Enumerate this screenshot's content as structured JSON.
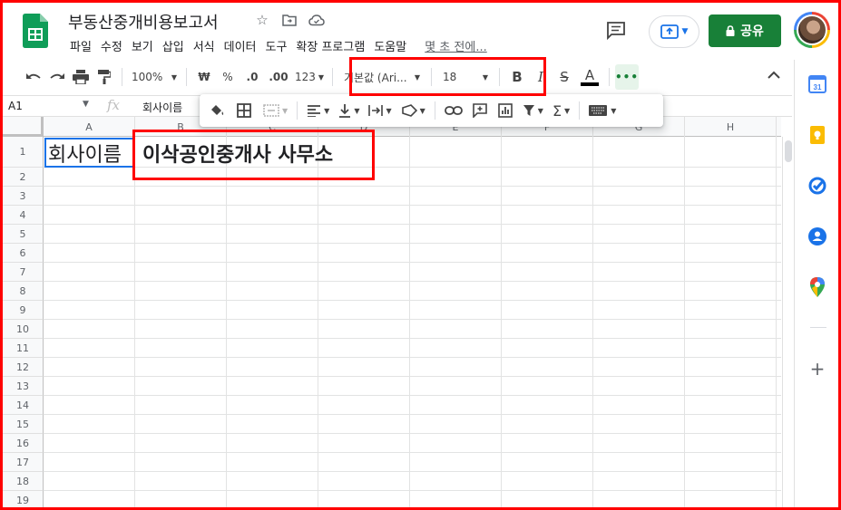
{
  "header": {
    "title": "부동산중개비용보고서",
    "menu": [
      "파일",
      "수정",
      "보기",
      "삽입",
      "서식",
      "데이터",
      "도구",
      "확장 프로그램",
      "도움말"
    ],
    "last_edit": "몇 초 전에...",
    "share_label": "공유"
  },
  "toolbar": {
    "zoom": "100%",
    "currency": "₩",
    "percent": "%",
    "decrease_decimal": ".0",
    "increase_decimal": ".00",
    "number_format": "123",
    "font_name": "기본값 (Ari...",
    "font_size": "18",
    "bold": "B",
    "italic": "I",
    "strike": "S",
    "text_color": "A",
    "text_color_value": "#000000"
  },
  "formula_bar": {
    "cell_ref": "A1",
    "fx": "fx",
    "value": "회사이름"
  },
  "grid": {
    "columns": [
      "A",
      "B",
      "C",
      "D",
      "E",
      "F",
      "G",
      "H"
    ],
    "rows": [
      "1",
      "2",
      "3",
      "4",
      "5",
      "6",
      "7",
      "8",
      "9",
      "10",
      "11",
      "12",
      "13",
      "14",
      "15",
      "16",
      "17",
      "18",
      "19"
    ],
    "cells": {
      "A1": "회사이름",
      "B1": "이삭공인중개사 사무소"
    }
  },
  "colors": {
    "share_button": "#188038",
    "selection": "#1a73e8",
    "highlight": "#ff0000"
  }
}
